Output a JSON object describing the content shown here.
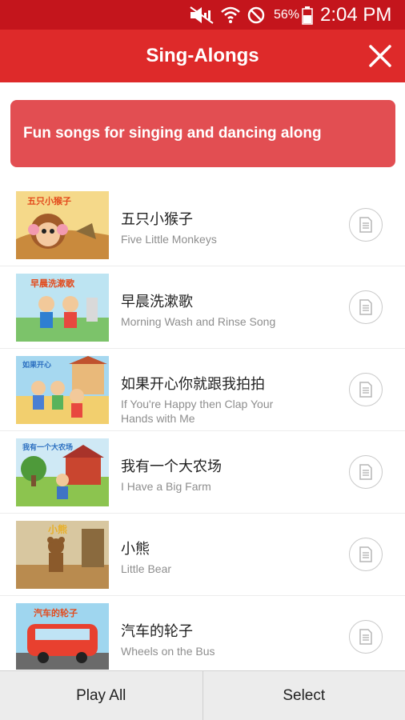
{
  "status_bar": {
    "battery_percent": "56%",
    "time": "2:04 PM",
    "icons": [
      "mute-icon",
      "wifi-icon",
      "do-not-disturb-icon",
      "battery-icon"
    ]
  },
  "app_bar": {
    "title": "Sing-Alongs",
    "close_icon": "close-icon"
  },
  "banner": {
    "text": "Fun songs for singing and dancing along"
  },
  "songs": [
    {
      "title_cn": "五只小猴子",
      "title_en": "Five Little Monkeys",
      "thumb_caption": "五只小猴子"
    },
    {
      "title_cn": "早晨洗漱歌",
      "title_en": "Morning Wash and Rinse Song",
      "thumb_caption": "早晨洗漱歌"
    },
    {
      "title_cn": "如果开心你就跟我拍拍",
      "title_en": "If You're Happy then Clap Your Hands with Me",
      "thumb_caption": "如果开心"
    },
    {
      "title_cn": "我有一个大农场",
      "title_en": " I Have a Big Farm",
      "thumb_caption": "我有一个大农场"
    },
    {
      "title_cn": "小熊",
      "title_en": "Little Bear",
      "thumb_caption": "小熊"
    },
    {
      "title_cn": "汽车的轮子",
      "title_en": "Wheels on the Bus",
      "thumb_caption": "汽车的轮子"
    }
  ],
  "bottom_bar": {
    "play_all_label": "Play All",
    "select_label": "Select"
  },
  "colors": {
    "status_bar": "#c4151c",
    "app_bar": "#de2a2a",
    "banner": "#e24e52",
    "bottom_bar": "#ececec"
  }
}
